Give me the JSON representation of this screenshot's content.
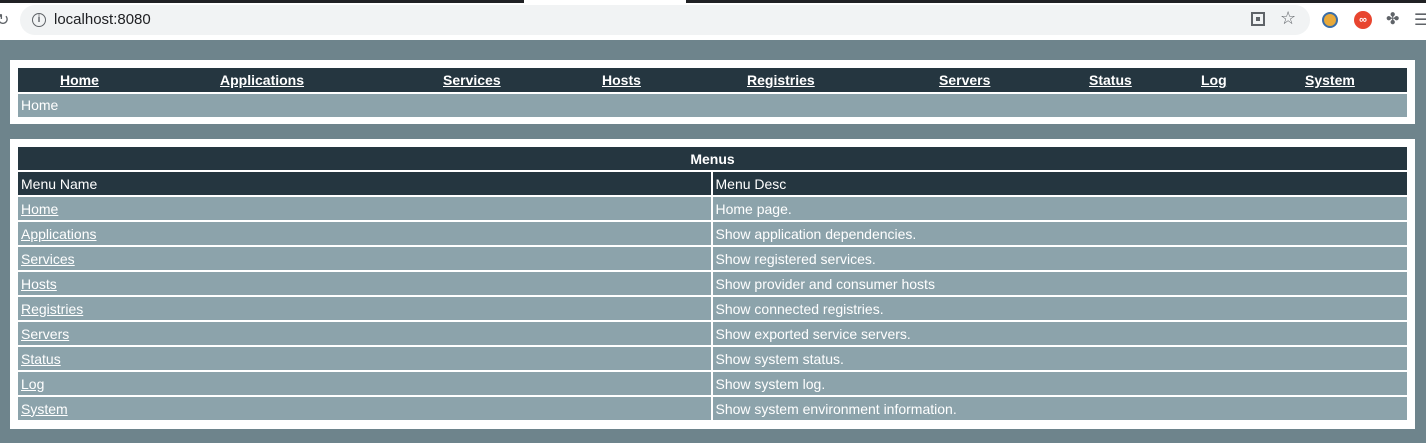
{
  "browser": {
    "url": "localhost:8080"
  },
  "nav": {
    "items": [
      "Home",
      "Applications",
      "Services",
      "Hosts",
      "Registries",
      "Servers",
      "Status",
      "Log",
      "System"
    ],
    "breadcrumb": "Home"
  },
  "menus": {
    "title": "Menus",
    "col_name": "Menu Name",
    "col_desc": "Menu Desc",
    "rows": [
      {
        "name": "Home",
        "desc": "Home page."
      },
      {
        "name": "Applications",
        "desc": "Show application dependencies."
      },
      {
        "name": "Services",
        "desc": "Show registered services."
      },
      {
        "name": "Hosts",
        "desc": "Show provider and consumer hosts"
      },
      {
        "name": "Registries",
        "desc": "Show connected registries."
      },
      {
        "name": "Servers",
        "desc": "Show exported service servers."
      },
      {
        "name": "Status",
        "desc": "Show system status."
      },
      {
        "name": "Log",
        "desc": "Show system log."
      },
      {
        "name": "System",
        "desc": "Show system environment information."
      }
    ]
  },
  "colors": {
    "page_bg": "#6e848c",
    "dark_header": "#253640",
    "row_bg": "#8ca3ab"
  }
}
